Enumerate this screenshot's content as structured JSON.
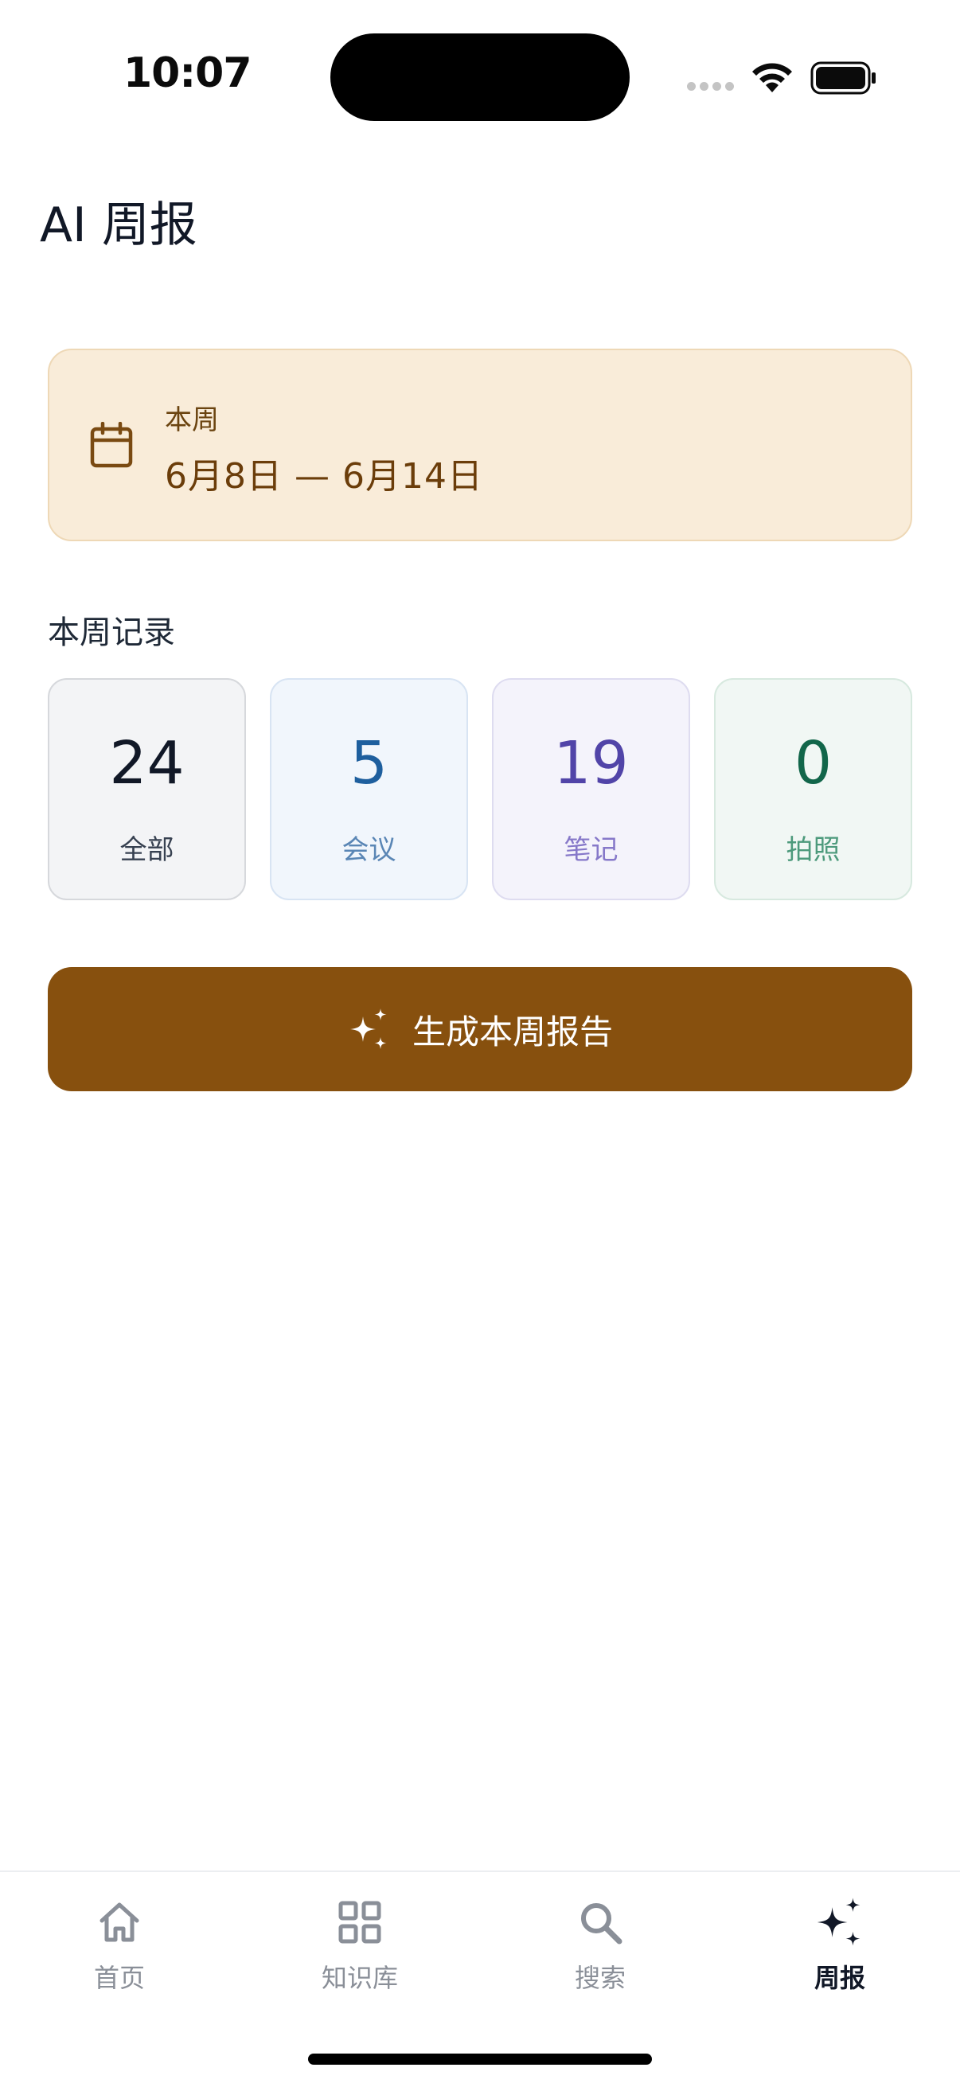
{
  "status_bar": {
    "time": "10:07"
  },
  "header": {
    "title": "AI 周报"
  },
  "week": {
    "label": "本周",
    "range": "6月8日 — 6月14日"
  },
  "records": {
    "title": "本周记录",
    "stats": [
      {
        "value": "24",
        "label": "全部",
        "color": "#111827"
      },
      {
        "value": "5",
        "label": "会议",
        "color": "#1e5f9e"
      },
      {
        "value": "19",
        "label": "笔记",
        "color": "#5144a8"
      },
      {
        "value": "0",
        "label": "拍照",
        "color": "#12664a"
      }
    ]
  },
  "generate_button": {
    "label": "生成本周报告",
    "icon": "sparkles-icon",
    "color": "#87500e"
  },
  "tabbar": {
    "items": [
      {
        "label": "首页",
        "icon": "home-icon"
      },
      {
        "label": "知识库",
        "icon": "grid-icon"
      },
      {
        "label": "搜索",
        "icon": "search-icon"
      },
      {
        "label": "周报",
        "icon": "sparkles-icon",
        "active": true
      }
    ]
  }
}
